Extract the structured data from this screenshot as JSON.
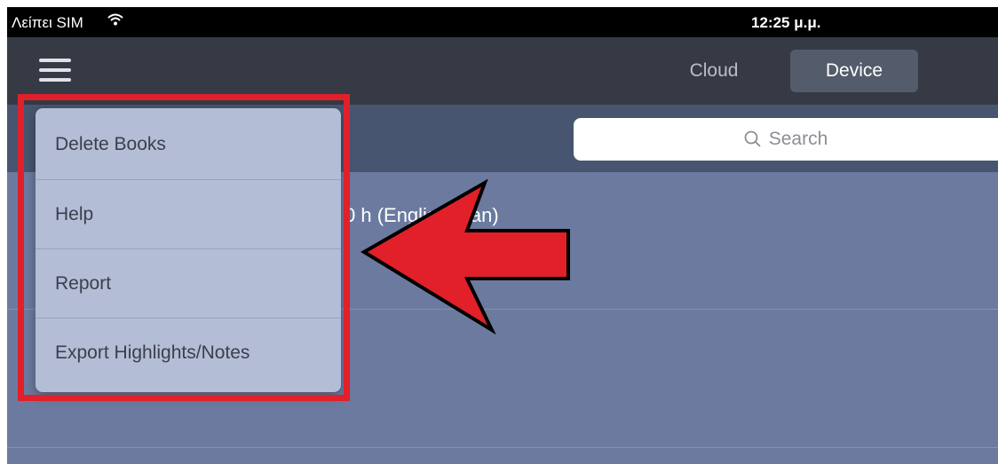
{
  "status_bar": {
    "carrier": "Λείπει SIM",
    "wifi_icon": "wifi-icon",
    "time": "12:25 μ.μ."
  },
  "nav_bar": {
    "menu_icon": "hamburger-menu-icon",
    "segments": [
      {
        "label": "Cloud",
        "selected": false
      },
      {
        "label": "Device",
        "selected": true
      }
    ]
  },
  "search": {
    "placeholder": "Search",
    "icon": "search-icon"
  },
  "book_list": {
    "items": [
      {
        "title_visible": "0 h (Englis  orean)"
      }
    ]
  },
  "menu": {
    "items": [
      {
        "label": "Delete Books"
      },
      {
        "label": "Help"
      },
      {
        "label": "Report"
      },
      {
        "label": "Export Highlights/Notes"
      }
    ]
  },
  "annotation": {
    "highlight_color": "#e1202a",
    "arrow_color": "#e1202a",
    "arrow_direction": "left"
  },
  "colors": {
    "nav_background": "#363a44",
    "search_band": "#475570",
    "list_background": "#6b7a9e",
    "menu_background": "#b4bdd6"
  }
}
